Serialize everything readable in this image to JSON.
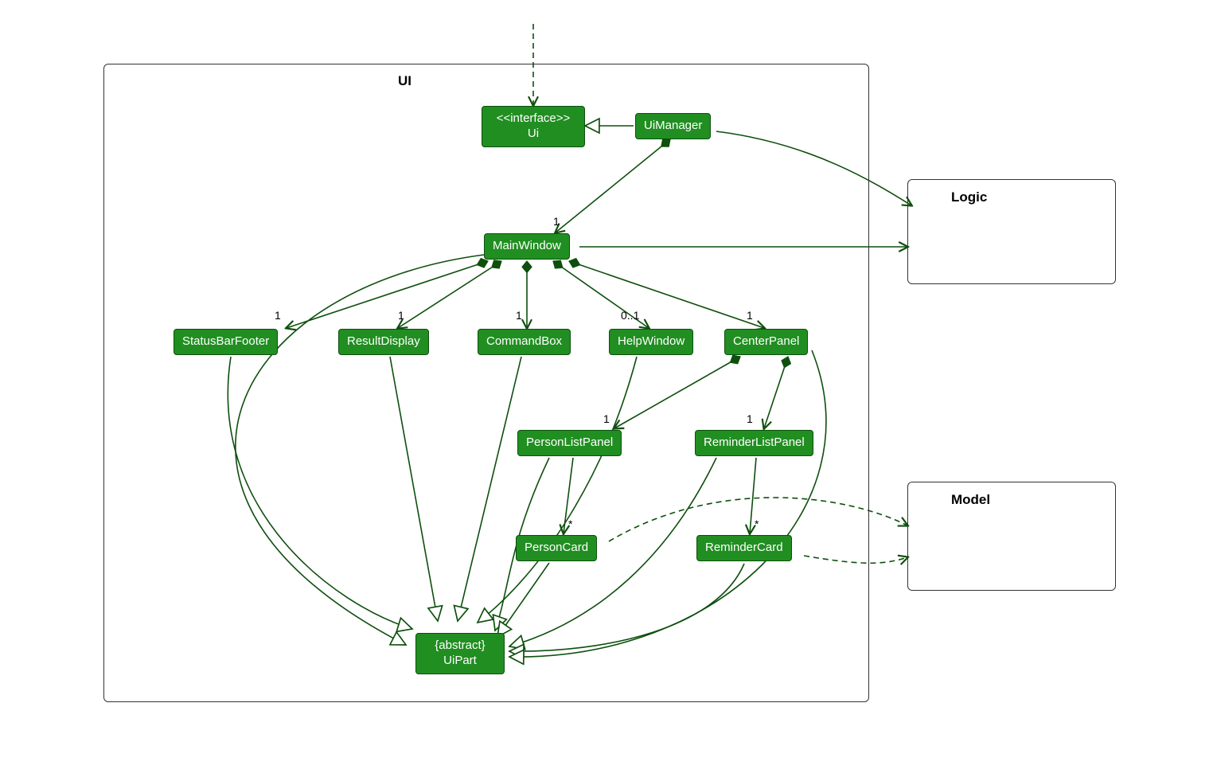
{
  "packages": {
    "ui": {
      "label": "UI"
    },
    "logic": {
      "label": "Logic"
    },
    "model": {
      "label": "Model"
    }
  },
  "classes": {
    "ui_interface": {
      "stereotype": "<<interface>>",
      "name": "Ui"
    },
    "ui_manager": {
      "name": "UiManager"
    },
    "main_window": {
      "name": "MainWindow"
    },
    "status_bar_footer": {
      "name": "StatusBarFooter"
    },
    "result_display": {
      "name": "ResultDisplay"
    },
    "command_box": {
      "name": "CommandBox"
    },
    "help_window": {
      "name": "HelpWindow"
    },
    "center_panel": {
      "name": "CenterPanel"
    },
    "person_list_panel": {
      "name": "PersonListPanel"
    },
    "reminder_list_panel": {
      "name": "ReminderListPanel"
    },
    "person_card": {
      "name": "PersonCard"
    },
    "reminder_card": {
      "name": "ReminderCard"
    },
    "ui_part": {
      "stereotype": "{abstract}",
      "name": "UiPart"
    }
  },
  "multiplicities": {
    "main_window": "1",
    "status_bar_footer": "1",
    "result_display": "1",
    "command_box": "1",
    "help_window": "0..1",
    "center_panel": "1",
    "person_list_panel": "1",
    "reminder_list_panel": "1",
    "person_card": "*",
    "reminder_card": "*"
  },
  "colors": {
    "class_fill": "#218e21",
    "class_border": "#0e4f0e",
    "line": "#0e4f0e"
  },
  "relations": [
    {
      "from": "external",
      "to": "ui_interface",
      "type": "dependency"
    },
    {
      "from": "ui_manager",
      "to": "ui_interface",
      "type": "realization"
    },
    {
      "from": "ui_manager",
      "to": "main_window",
      "type": "composition",
      "mult": "1"
    },
    {
      "from": "ui_manager",
      "to": "logic",
      "type": "association"
    },
    {
      "from": "main_window",
      "to": "status_bar_footer",
      "type": "composition",
      "mult": "1"
    },
    {
      "from": "main_window",
      "to": "result_display",
      "type": "composition",
      "mult": "1"
    },
    {
      "from": "main_window",
      "to": "command_box",
      "type": "composition",
      "mult": "1"
    },
    {
      "from": "main_window",
      "to": "help_window",
      "type": "composition",
      "mult": "0..1"
    },
    {
      "from": "main_window",
      "to": "center_panel",
      "type": "composition",
      "mult": "1"
    },
    {
      "from": "main_window",
      "to": "logic",
      "type": "association"
    },
    {
      "from": "center_panel",
      "to": "person_list_panel",
      "type": "composition",
      "mult": "1"
    },
    {
      "from": "center_panel",
      "to": "reminder_list_panel",
      "type": "composition",
      "mult": "1"
    },
    {
      "from": "person_list_panel",
      "to": "person_card",
      "type": "association",
      "mult": "*"
    },
    {
      "from": "reminder_list_panel",
      "to": "reminder_card",
      "type": "association",
      "mult": "*"
    },
    {
      "from": "main_window",
      "to": "ui_part",
      "type": "generalization"
    },
    {
      "from": "status_bar_footer",
      "to": "ui_part",
      "type": "generalization"
    },
    {
      "from": "result_display",
      "to": "ui_part",
      "type": "generalization"
    },
    {
      "from": "command_box",
      "to": "ui_part",
      "type": "generalization"
    },
    {
      "from": "help_window",
      "to": "ui_part",
      "type": "generalization"
    },
    {
      "from": "center_panel",
      "to": "ui_part",
      "type": "generalization"
    },
    {
      "from": "person_list_panel",
      "to": "ui_part",
      "type": "generalization"
    },
    {
      "from": "reminder_list_panel",
      "to": "ui_part",
      "type": "generalization"
    },
    {
      "from": "person_card",
      "to": "ui_part",
      "type": "generalization"
    },
    {
      "from": "reminder_card",
      "to": "ui_part",
      "type": "generalization"
    },
    {
      "from": "person_card",
      "to": "model",
      "type": "dependency"
    },
    {
      "from": "reminder_card",
      "to": "model",
      "type": "dependency"
    }
  ]
}
